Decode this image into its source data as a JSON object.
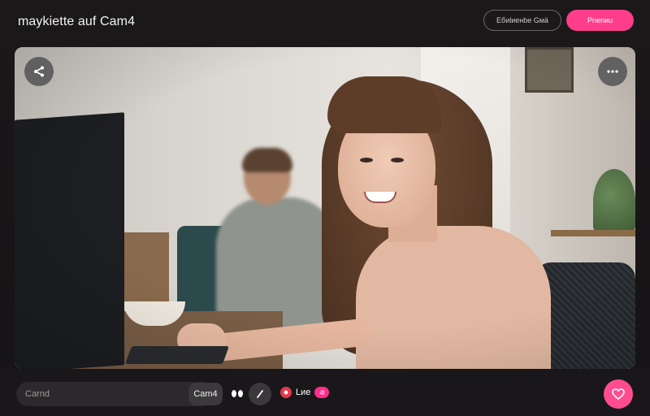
{
  "header": {
    "title": "maykiette auf Cam4",
    "secondary_button": "Ебиlиенbe Gмä",
    "primary_button": "Pnenиu"
  },
  "video": {
    "share_icon": "share-icon",
    "more_icon": "more-icon"
  },
  "footer": {
    "input_placeholder": "Carnd",
    "tag_label": "Cam4",
    "live_label": "Lиe",
    "live_badge": "4l",
    "heart_icon": "heart-icon"
  },
  "colors": {
    "accent": "#ff3d8b",
    "background": "#1a1819"
  }
}
